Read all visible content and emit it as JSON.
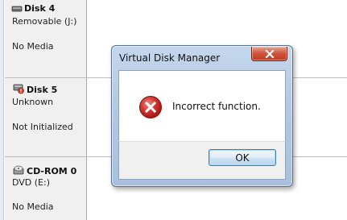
{
  "disks": [
    {
      "name": "Disk 4",
      "type": "Removable (J:)",
      "status": "No Media",
      "icon": "removable-disk-icon"
    },
    {
      "name": "Disk 5",
      "type": "Unknown",
      "status": "Not Initialized",
      "icon": "disk-error-icon"
    },
    {
      "name": "CD-ROM 0",
      "type": "DVD (E:)",
      "status": "No Media",
      "icon": "cdrom-drive-icon"
    }
  ],
  "dialog": {
    "title": "Virtual Disk Manager",
    "message": "Incorrect function.",
    "ok_label": "OK",
    "icon": "error-icon",
    "close_icon": "close-icon"
  },
  "colors": {
    "error_red": "#c8282a",
    "close_button_red": "#c7432b",
    "title_bar_blue": "#b9cde5"
  }
}
